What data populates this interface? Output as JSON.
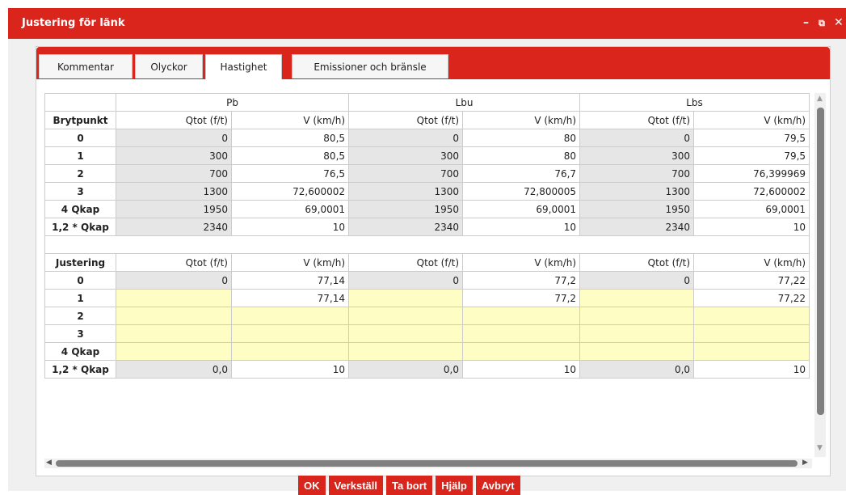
{
  "window": {
    "title": "Justering för länk",
    "min_glyph": "–",
    "popout_glyph": "⧉",
    "close_glyph": "✕"
  },
  "tabs": [
    {
      "label": "Kommentar",
      "active": false
    },
    {
      "label": "Olyckor",
      "active": false
    },
    {
      "label": "Hastighet",
      "active": true
    },
    {
      "label": "Emissioner och bränsle",
      "active": false
    }
  ],
  "table": {
    "groups": [
      "Pb",
      "Lbu",
      "Lbs"
    ],
    "col_q": "Qtot (f/t)",
    "col_v": "V (km/h)",
    "section1_label": "Brytpunkt",
    "section2_label": "Justering",
    "brytpunkt_rows": [
      {
        "label": "0",
        "vals": [
          "0",
          "80,5",
          "0",
          "80",
          "0",
          "79,5"
        ]
      },
      {
        "label": "1",
        "vals": [
          "300",
          "80,5",
          "300",
          "80",
          "300",
          "79,5"
        ]
      },
      {
        "label": "2",
        "vals": [
          "700",
          "76,5",
          "700",
          "76,7",
          "700",
          "76,399969"
        ]
      },
      {
        "label": "3",
        "vals": [
          "1300",
          "72,600002",
          "1300",
          "72,800005",
          "1300",
          "72,600002"
        ]
      },
      {
        "label": "4 Qkap",
        "vals": [
          "1950",
          "69,0001",
          "1950",
          "69,0001",
          "1950",
          "69,0001"
        ]
      },
      {
        "label": "1,2 * Qkap",
        "vals": [
          "2340",
          "10",
          "2340",
          "10",
          "2340",
          "10"
        ]
      }
    ],
    "justering_rows": [
      {
        "label": "0",
        "vals": [
          "0",
          "77,14",
          "0",
          "77,2",
          "0",
          "77,22"
        ]
      },
      {
        "label": "1",
        "vals": [
          "",
          "77,14",
          "",
          "77,2",
          "",
          "77,22"
        ]
      },
      {
        "label": "2",
        "vals": [
          "",
          "",
          "",
          "",
          "",
          ""
        ]
      },
      {
        "label": "3",
        "vals": [
          "",
          "",
          "",
          "",
          "",
          ""
        ]
      },
      {
        "label": "4 Qkap",
        "vals": [
          "",
          "",
          "",
          "",
          "",
          ""
        ]
      },
      {
        "label": "1,2 * Qkap",
        "vals": [
          "0,0",
          "10",
          "0,0",
          "10",
          "0,0",
          "10"
        ]
      }
    ]
  },
  "buttons": {
    "ok": "OK",
    "apply": "Verkställ",
    "delete": "Ta bort",
    "help": "Hjälp",
    "cancel": "Avbryt"
  },
  "colors": {
    "accent": "#d9251c",
    "readonly_cell": "#e6e6e6",
    "editable_cell": "#fdfdc4"
  }
}
